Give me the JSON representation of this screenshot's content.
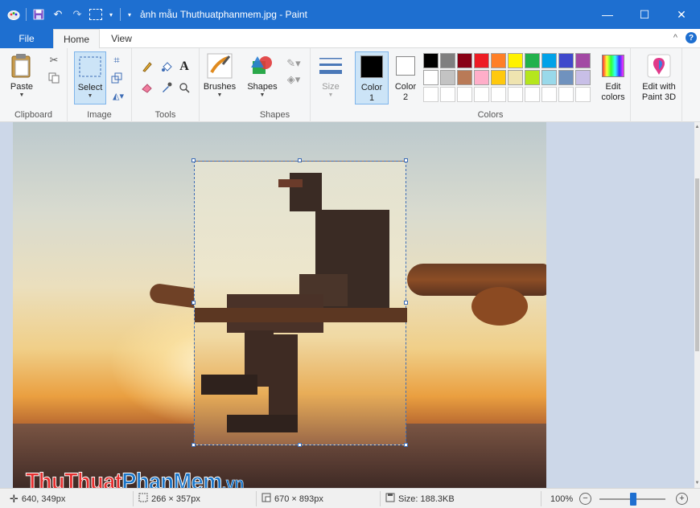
{
  "window": {
    "title": "ảnh mẫu Thuthuatphanmem.jpg - Paint",
    "controls": {
      "minimize": "—",
      "maximize": "☐",
      "close": "✕"
    }
  },
  "quick_access": {
    "save_icon": "save-icon",
    "undo_icon": "undo-icon",
    "redo_icon": "redo-icon",
    "select_icon": "select-icon"
  },
  "tabs": {
    "file": "File",
    "home": "Home",
    "view": "View",
    "collapse": "^",
    "help": "?"
  },
  "ribbon": {
    "clipboard": {
      "label": "Clipboard",
      "paste": "Paste"
    },
    "image": {
      "label": "Image",
      "select": "Select"
    },
    "tools": {
      "label": "Tools"
    },
    "brushes": {
      "label": "Brushes"
    },
    "shapes": {
      "label": "Shapes",
      "shapes_btn": "Shapes"
    },
    "size": {
      "label": "Size"
    },
    "color1": {
      "label_1": "Color",
      "label_2": "1"
    },
    "color2": {
      "label_1": "Color",
      "label_2": "2"
    },
    "colors": {
      "label": "Colors"
    },
    "edit_colors": {
      "label_1": "Edit",
      "label_2": "colors"
    },
    "paint3d": {
      "label_1": "Edit with",
      "label_2": "Paint 3D"
    },
    "palette": [
      "#000000",
      "#7f7f7f",
      "#880015",
      "#ed1c24",
      "#ff7f27",
      "#fff200",
      "#22b14c",
      "#00a2e8",
      "#3f48cc",
      "#a349a4",
      "#ffffff",
      "#c3c3c3",
      "#b97a57",
      "#ffaec9",
      "#ffc90e",
      "#efe4b0",
      "#b5e61d",
      "#99d9ea",
      "#7092be",
      "#c8bfe7",
      "",
      "",
      "",
      "",
      "",
      "",
      "",
      "",
      "",
      ""
    ],
    "color1_value": "#000000",
    "color2_value": "#ffffff"
  },
  "canvas": {
    "watermark": {
      "part1": "ThuThuat",
      "part2": "PhanMem",
      "part3": ".vn"
    }
  },
  "statusbar": {
    "cursor_pos": "640, 349px",
    "selection_size": "266 × 357px",
    "image_size": "670 × 893px",
    "file_size": "Size: 188.3KB",
    "zoom": "100%",
    "zoom_out": "−",
    "zoom_in": "+"
  },
  "colors": {
    "accent": "#1e6fd0",
    "ribbon_bg": "#f5f6f7",
    "workspace_bg": "#ccd7e8"
  }
}
